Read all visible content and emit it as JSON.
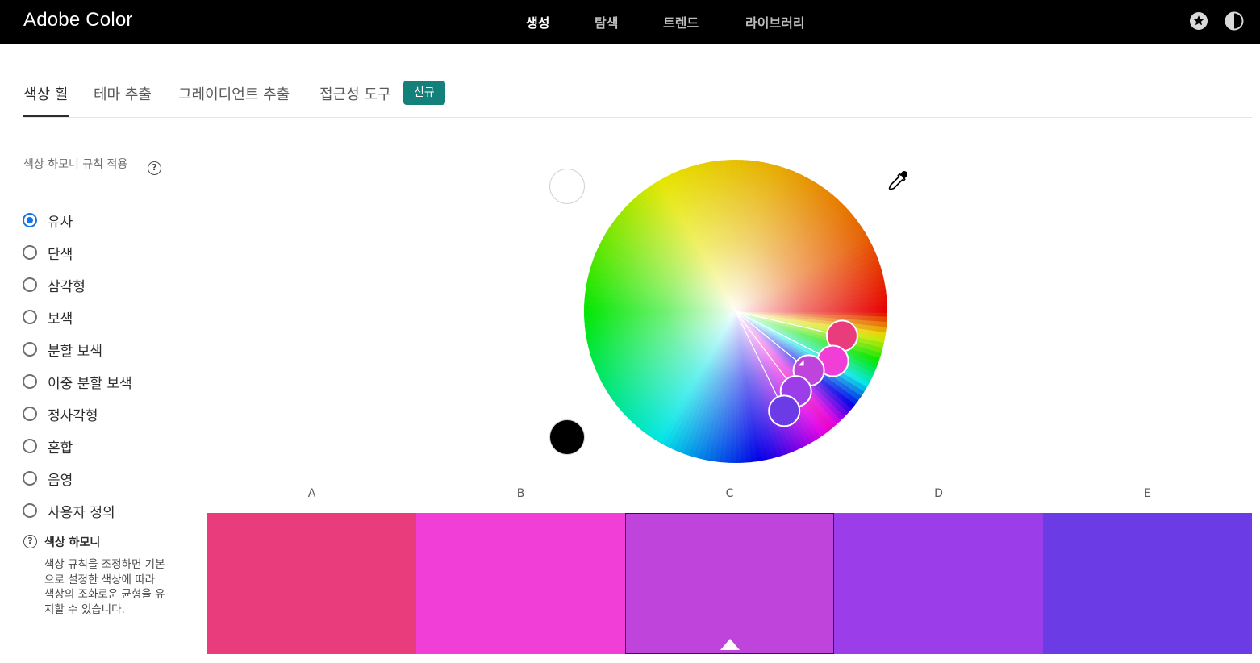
{
  "app": {
    "title": "Adobe Color",
    "nav": [
      {
        "label": "생성",
        "active": true
      },
      {
        "label": "탐색",
        "active": false
      },
      {
        "label": "트렌드",
        "active": false
      },
      {
        "label": "라이브러리",
        "active": false
      }
    ],
    "icons": [
      "star-icon",
      "dark-mode-icon"
    ]
  },
  "tabs": {
    "items": [
      {
        "label": "색상 휠",
        "active": true
      },
      {
        "label": "테마 추출",
        "active": false
      },
      {
        "label": "그레이디언트 추출",
        "active": false
      },
      {
        "label": "접근성 도구",
        "active": false
      }
    ],
    "badge": "신규"
  },
  "sidebar": {
    "rule_title": "색상 하모니 규칙 적용",
    "help_glyph": "?",
    "rules": [
      {
        "label": "유사",
        "checked": true
      },
      {
        "label": "단색",
        "checked": false
      },
      {
        "label": "삼각형",
        "checked": false
      },
      {
        "label": "보색",
        "checked": false
      },
      {
        "label": "분할 보색",
        "checked": false
      },
      {
        "label": "이중 분할 보색",
        "checked": false
      },
      {
        "label": "정사각형",
        "checked": false
      },
      {
        "label": "혼합",
        "checked": false
      },
      {
        "label": "음영",
        "checked": false
      },
      {
        "label": "사용자 정의",
        "checked": false
      }
    ],
    "info": {
      "title": "색상 하모니",
      "body": "색상 규칙을 조정하면 기본으로 설정한 색상에 따라 색상의 조화로운 균형을 유지할 수 있습니다."
    }
  },
  "wheel": {
    "icons": [
      "eyedropper-icon",
      "white-swatch",
      "black-swatch"
    ],
    "handle_colors": [
      "#e93c7c",
      "#f03ed6",
      "#bf44dc",
      "#9b3de8",
      "#6b3be6"
    ],
    "base_index": 2
  },
  "swatches": {
    "items": [
      {
        "label": "A",
        "color": "#e93c7c"
      },
      {
        "label": "B",
        "color": "#f03ed6"
      },
      {
        "label": "C",
        "color": "#bf44dc"
      },
      {
        "label": "D",
        "color": "#9b3de8"
      },
      {
        "label": "E",
        "color": "#6b3be6"
      }
    ],
    "selected_index": 2
  }
}
